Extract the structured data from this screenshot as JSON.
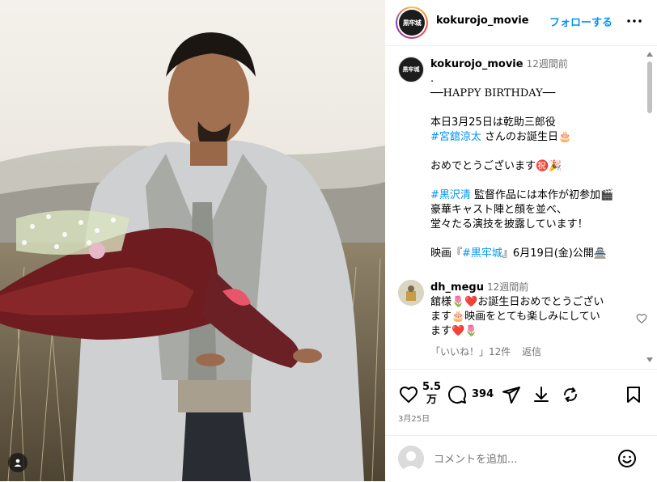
{
  "post": {
    "username": "kokurojo_movie",
    "avatar_text": "黒牢城",
    "follow_label": "フォローする",
    "more_icon": "more-horizontal-icon"
  },
  "caption": {
    "username": "kokurojo_movie",
    "time": "12週間前",
    "dot": ".",
    "line_birthday": "──HAPPY BIRTHDAY──",
    "line1": "本日3月25日は乾助三郎役",
    "hashtag_name": "#宮舘涼太",
    "line2_rest": " さんのお誕生日🎂",
    "line3": "おめでとうございます㊗️🎉",
    "hashtag_director": "#黒沢清",
    "line4_rest": " 監督作品には本作が初参加🎬",
    "line5": "豪華キャスト陣と顔を並べ、",
    "line6": "堂々たる演技を披露しています！",
    "line7_pre": "映画『",
    "hashtag_movie": "#黒牢城",
    "line7_post": "』6月19日(金)公開🏯"
  },
  "comment": {
    "username": "dh_megu",
    "time": "12週間前",
    "text": "舘様🌷❤️お誕生日おめでとうございます🎂映画をとても楽しみにしています❤️🌷",
    "likes": "「いいね！」12件",
    "reply": "返信"
  },
  "actions": {
    "like_count": "5.5万",
    "like_count_top": "5.5",
    "like_count_bottom": "万",
    "comment_count": "394",
    "date": "3月25日"
  },
  "add_comment": {
    "placeholder": "コメントを追加..."
  },
  "colors": {
    "accent": "#0095f6",
    "muted": "#737373",
    "divider": "#efefef"
  }
}
